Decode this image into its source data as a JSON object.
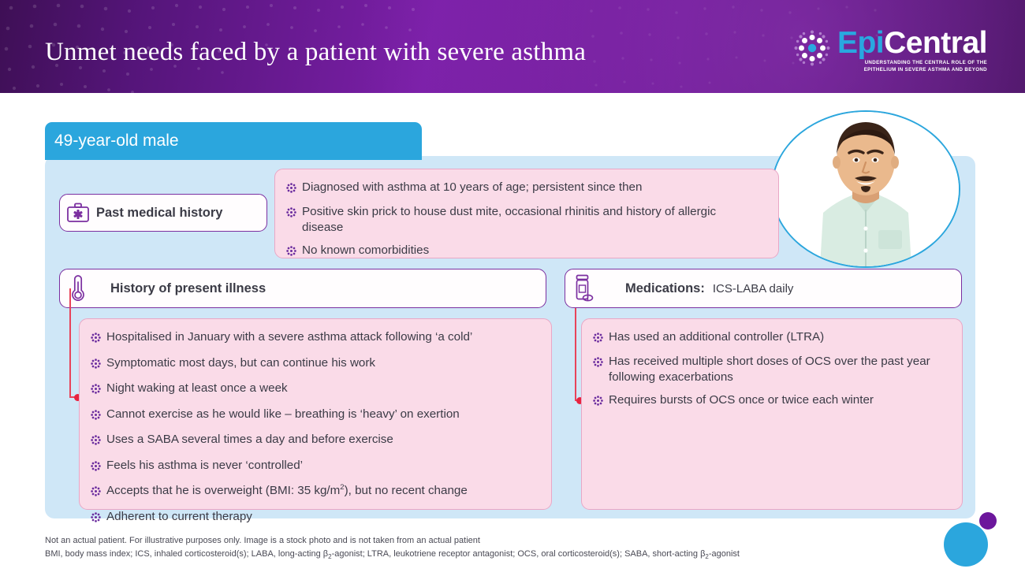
{
  "header": {
    "title": "Unmet needs faced by a patient with severe asthma",
    "logo": {
      "word_primary": "Epi",
      "word_secondary": "Central",
      "tagline_line1": "UNDERSTANDING THE CENTRAL ROLE OF THE",
      "tagline_line2": "EPITHELIUM IN SEVERE ASTHMA AND BEYOND"
    },
    "colors": {
      "purple_dark": "#3c0d52",
      "purple_light": "#7b1fa8",
      "logo_blue": "#29a8e0"
    }
  },
  "patient": {
    "banner_label": "49-year-old male"
  },
  "sections": {
    "past_medical_history": {
      "label": "Past medical history",
      "icon": "medical-bag-icon",
      "bullets": [
        "Diagnosed with asthma at 10 years of age; persistent since then",
        "Positive skin prick to house dust mite, occasional rhinitis and history of allergic disease",
        "No known comorbidities"
      ]
    },
    "history_of_present_illness": {
      "label": "History of present illness",
      "icon": "thermometer-icon",
      "bullets": [
        "Hospitalised in January with a severe asthma attack following ‘a cold’",
        "Symptomatic most days, but can continue his work",
        "Night waking at least once a week",
        "Cannot exercise as he would like – breathing is ‘heavy’ on exertion",
        "Uses a SABA several times a day and before exercise",
        "Feels his asthma is never ‘controlled’",
        "Adherent to current therapy"
      ],
      "bullet_bmi_prefix": "Accepts that he is overweight (BMI: 35 kg/m",
      "bullet_bmi_sup": "2",
      "bullet_bmi_suffix": "), but no recent change"
    },
    "medications": {
      "label": "Medications:",
      "value": "ICS-LABA daily",
      "icon": "pill-bottle-icon",
      "bullets": [
        "Has used an additional controller (LTRA)",
        "Has received multiple short doses of OCS over the past year following exacerbations",
        "Requires bursts of OCS once or twice each winter"
      ]
    }
  },
  "footnotes": {
    "disclaimer": "Not an actual patient. For illustrative purposes only. Image is a stock photo and is not taken from an actual patient",
    "abbrev_part1": "BMI, body mass index; ICS, inhaled corticosteroid(s); LABA, long-acting β",
    "abbrev_sub1": "2",
    "abbrev_part2": "-agonist; LTRA, leukotriene receptor antagonist; OCS, oral corticosteroid(s); SABA, short-acting β",
    "abbrev_sub2": "2",
    "abbrev_part3": "-agonist"
  },
  "theme": {
    "panel_blue": "#cfe7f7",
    "banner_blue": "#2ba6dd",
    "pink_box": "#fadbe8",
    "pink_border": "#e9a7c6",
    "purple_outline": "#7b2fa0",
    "connector_red": "#e8435a"
  }
}
